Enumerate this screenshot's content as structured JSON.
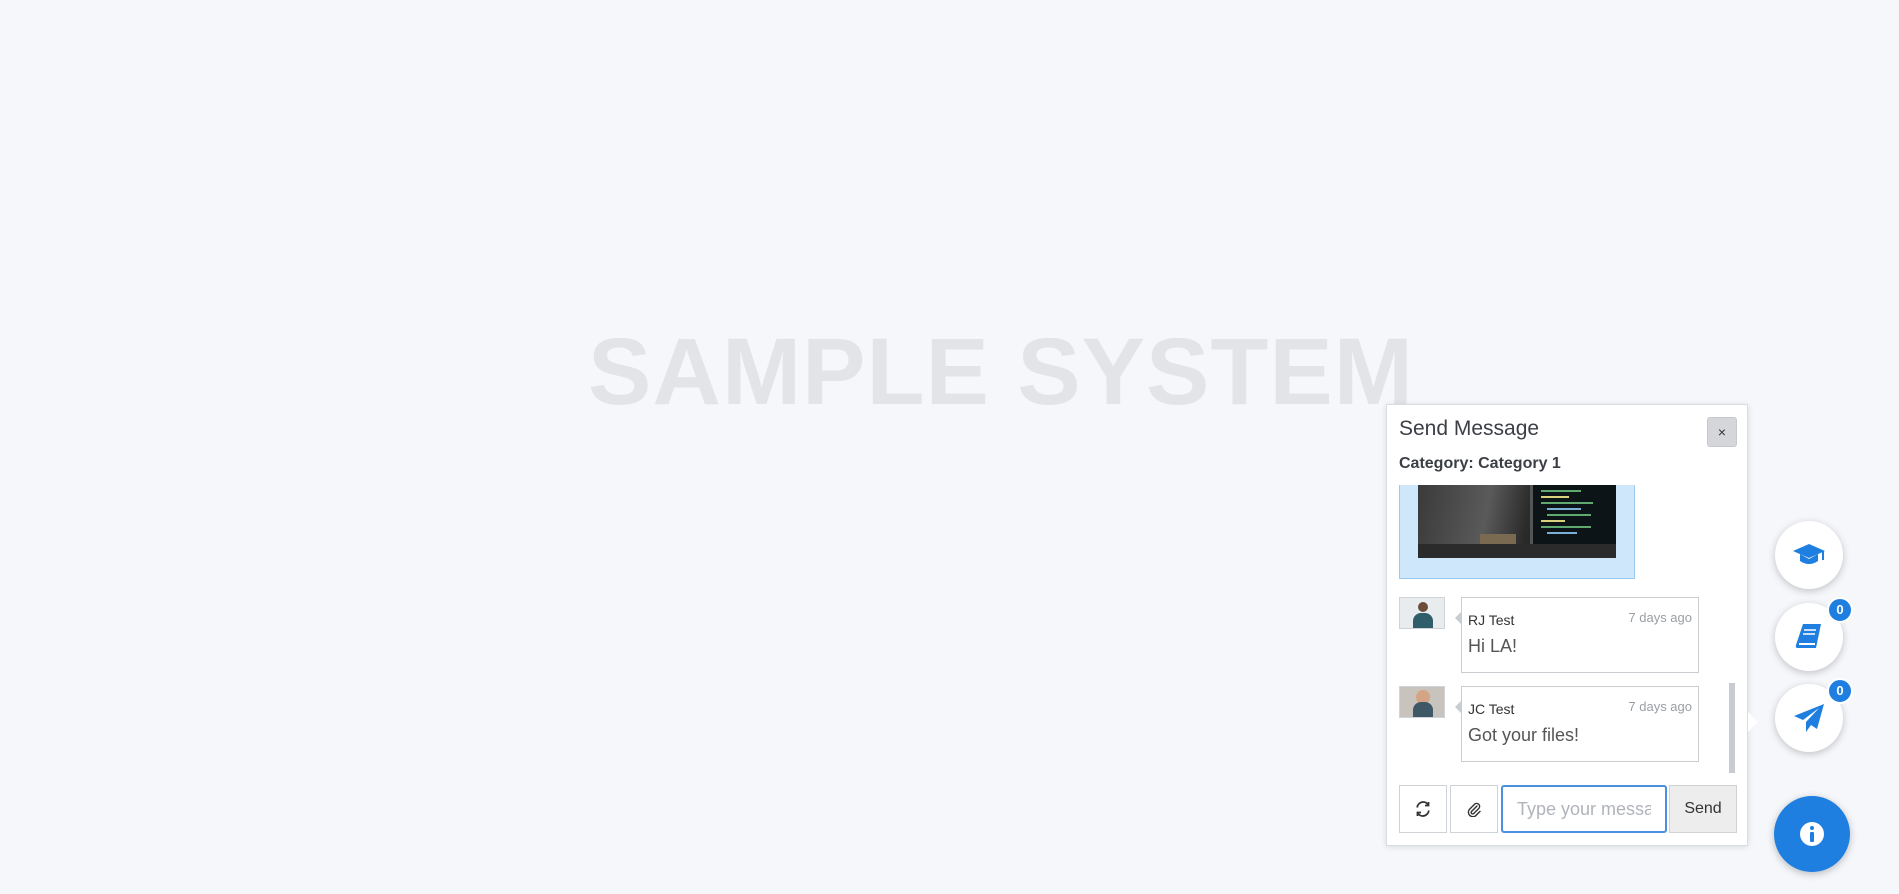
{
  "watermark": {
    "text": "SAMPLE SYSTEM"
  },
  "chat_panel": {
    "title": "Send Message",
    "category": "Category: Category 1",
    "close_label": "×",
    "messages": [
      {
        "sender": "RJ Test",
        "time": "7 days ago",
        "text": "Hi LA!"
      },
      {
        "sender": "JC Test",
        "time": "7 days ago",
        "text": "Got your files!"
      }
    ],
    "input": {
      "placeholder": "Type your message",
      "value": ""
    },
    "send_label": "Send",
    "refresh_icon": "refresh-icon",
    "attach_icon": "paperclip-icon"
  },
  "floating_buttons": [
    {
      "icon": "graduation-cap-icon",
      "badge": null
    },
    {
      "icon": "book-icon",
      "badge": "0"
    },
    {
      "icon": "paper-plane-icon",
      "badge": "0"
    },
    {
      "icon": "info-icon",
      "badge": null
    }
  ],
  "colors": {
    "accent": "#1e7fe0",
    "background": "#f5f7fb",
    "attachment_bg": "#cfe7fb"
  }
}
